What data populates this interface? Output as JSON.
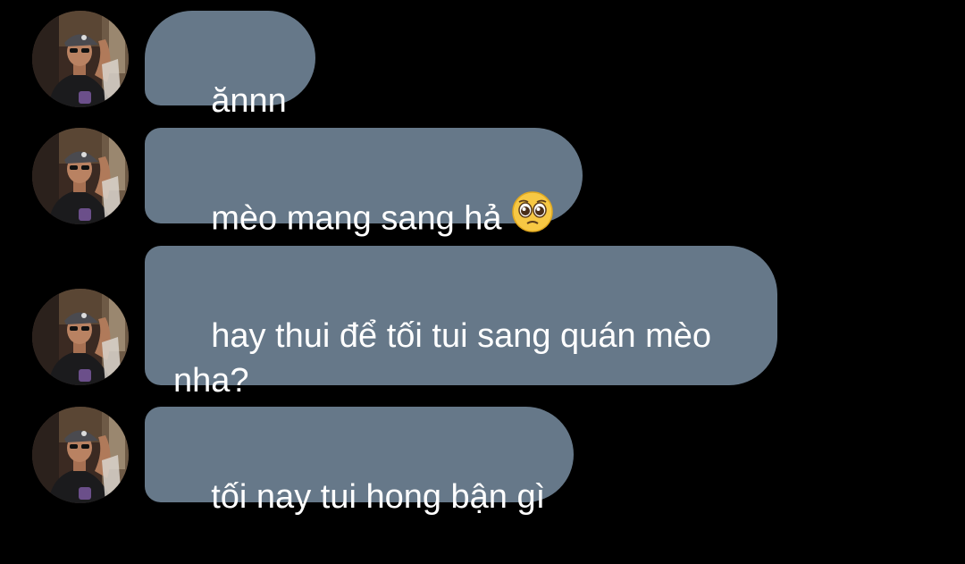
{
  "chat": {
    "messages": [
      {
        "text": "ănnn",
        "emoji": ""
      },
      {
        "text": "mèo mang sang hả",
        "emoji": "pleading-face-icon"
      },
      {
        "text": "hay thui để tối tui sang quán mèo nha?",
        "emoji": ""
      },
      {
        "text": "tối nay tui hong bận gì",
        "emoji": ""
      }
    ]
  },
  "colors": {
    "background": "#000000",
    "bubble": "#667889",
    "text": "#ffffff"
  }
}
